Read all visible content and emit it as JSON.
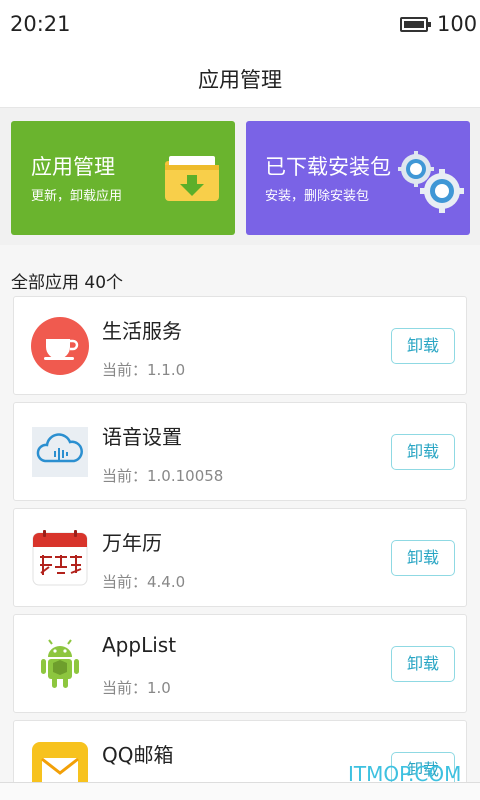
{
  "status_bar": {
    "time": "20:21",
    "battery": "100"
  },
  "header": {
    "title": "应用管理"
  },
  "cards": [
    {
      "title": "应用管理",
      "subtitle": "更新，卸载应用"
    },
    {
      "title": "已下载安装包",
      "subtitle": "安装，删除安装包"
    }
  ],
  "list": {
    "section_title": "全部应用 40个",
    "uninstall_label": "卸载",
    "apps": [
      {
        "name": "生活服务",
        "version": "当前：1.1.0"
      },
      {
        "name": "语音设置",
        "version": "当前：1.0.10058"
      },
      {
        "name": "万年历",
        "version": "当前：4.4.0"
      },
      {
        "name": "AppList",
        "version": "当前：1.0"
      },
      {
        "name": "QQ邮箱",
        "version": ""
      }
    ]
  },
  "watermark": "ITMOP.COM",
  "colors": {
    "green_card": "#6ab42e",
    "purple_card": "#7a63e6",
    "accent": "#2aa6c4"
  },
  "icons": [
    "battery-icon",
    "folder-download-icon",
    "gears-icon",
    "teacup-icon",
    "voice-cloud-icon",
    "calendar-icon",
    "android-icon",
    "mail-icon"
  ]
}
